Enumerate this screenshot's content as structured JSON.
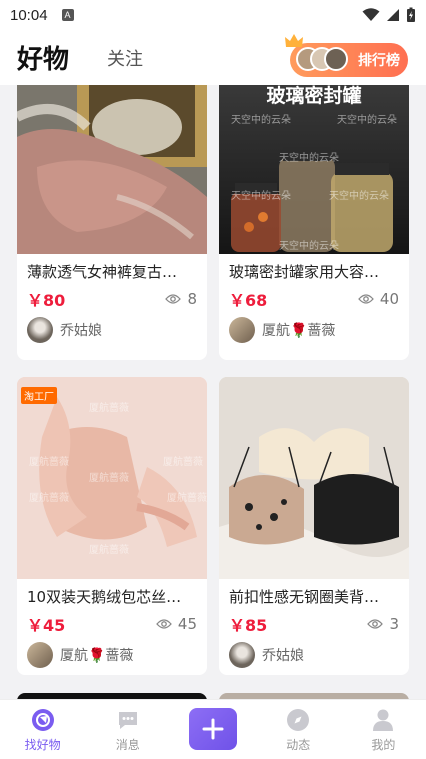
{
  "status": {
    "time": "10:04",
    "notif": "A"
  },
  "header": {
    "tab_active": "好物",
    "tab_inactive": "关注",
    "rank_label": "排行榜"
  },
  "cards": [
    {
      "title": "薄款透气女神裤复古…",
      "price": "￥80",
      "views": "8",
      "user": "乔姑娘"
    },
    {
      "title": "玻璃密封罐家用大容…",
      "price": "￥68",
      "views": "40",
      "user": "厦航🌹蔷薇",
      "image_text": "玻璃密封罐",
      "watermark": "天空中的云朵"
    },
    {
      "title": "10双装天鹅绒包芯丝…",
      "price": "￥45",
      "views": "45",
      "user": "厦航🌹蔷薇",
      "badge": "淘工厂",
      "watermark": "厦航蔷薇"
    },
    {
      "title": "前扣性感无钢圈美背…",
      "price": "￥85",
      "views": "3",
      "user": "乔姑娘"
    }
  ],
  "tabbar": {
    "items": [
      {
        "label": "找好物",
        "icon": "discover-icon"
      },
      {
        "label": "消息",
        "icon": "message-icon"
      },
      {
        "label": "",
        "icon": "plus-icon"
      },
      {
        "label": "动态",
        "icon": "compass-icon"
      },
      {
        "label": "我的",
        "icon": "user-icon"
      }
    ]
  },
  "colors": {
    "accent": "#7a5cf0",
    "price": "#ee1d3c",
    "rank": "#ff7f55"
  }
}
